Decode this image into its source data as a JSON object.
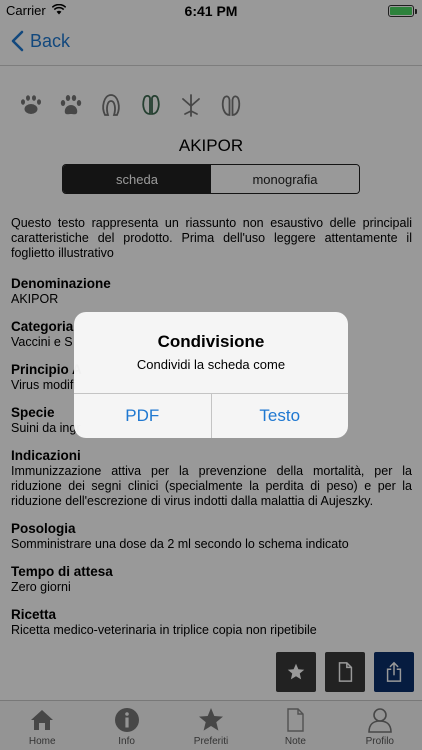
{
  "status_bar": {
    "carrier": "Carrier",
    "time": "6:41 PM"
  },
  "nav": {
    "back_label": "Back"
  },
  "species_icons": [
    "pig-paw-icon",
    "dog-paw-icon",
    "horse-hoof-icon",
    "cattle-hoof-icon",
    "bird-foot-icon",
    "sheep-hoof-icon"
  ],
  "product": {
    "title": "AKIPOR"
  },
  "segments": {
    "active": "scheda",
    "inactive": "monografia"
  },
  "content": {
    "intro": "Questo testo rappresenta un riassunto non esaustivo delle principali caratteristiche del prodotto. Prima dell'uso leggere attentamente il foglietto illustrativo",
    "sections": [
      {
        "title": "Denominazione",
        "body": "AKIPOR"
      },
      {
        "title": "Categoria",
        "body": "Vaccini e S"
      },
      {
        "title": "Principio A",
        "body": "Virus modifi"
      },
      {
        "title": "Specie",
        "body": "Suini da ingr"
      },
      {
        "title": "Indicazioni",
        "body": "Immunizzazione attiva per la prevenzione della mortalità, per la riduzione dei segni clinici (specialmente la perdita di peso) e per la riduzione dell'escrezione di virus indotti dalla malattia di Aujeszky."
      },
      {
        "title": "Posologia",
        "body": "Somministrare una dose da 2 ml secondo lo schema indicato"
      },
      {
        "title": "Tempo di attesa",
        "body": "Zero giorni"
      },
      {
        "title": "Ricetta",
        "body": "Ricetta medico-veterinaria in triplice copia non ripetibile"
      }
    ]
  },
  "fab": [
    "star-icon",
    "document-icon",
    "share-icon"
  ],
  "tabbar": {
    "tabs": [
      {
        "label": "Home",
        "icon": "home-icon"
      },
      {
        "label": "Info",
        "icon": "info-icon"
      },
      {
        "label": "Preferiti",
        "icon": "star-icon"
      },
      {
        "label": "Note",
        "icon": "note-icon"
      },
      {
        "label": "Profilo",
        "icon": "profile-icon"
      }
    ]
  },
  "alert": {
    "title": "Condivisione",
    "message": "Condividi la scheda come",
    "buttons": [
      "PDF",
      "Testo"
    ]
  },
  "colors": {
    "accent": "#1f78d1",
    "dark_button": "#3a3a3a",
    "share_button": "#0b2f6b",
    "segment_active": "#222222"
  }
}
